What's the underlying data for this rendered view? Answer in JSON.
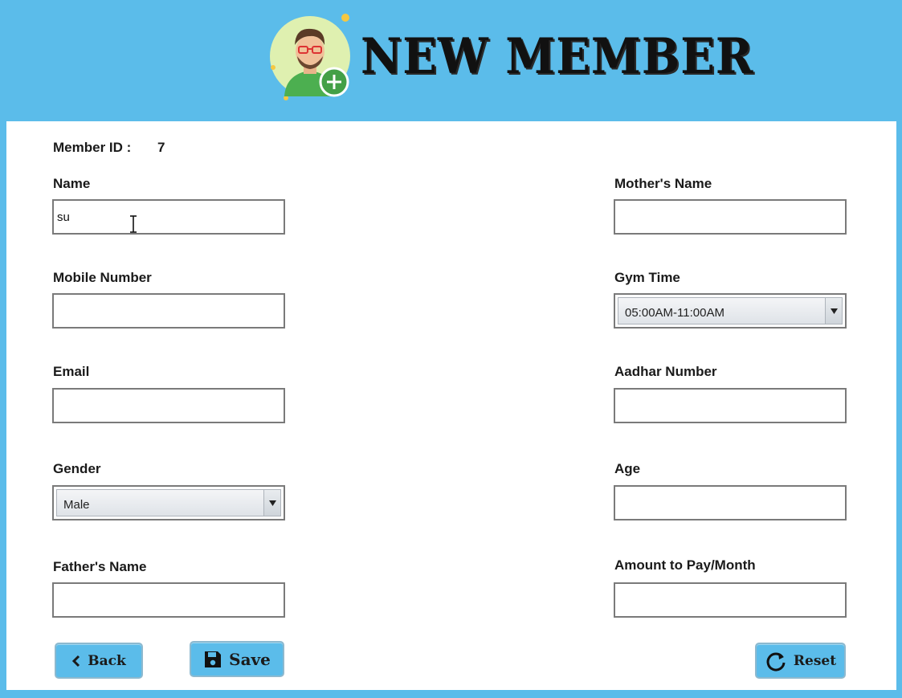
{
  "header": {
    "title": "NEW MEMBER"
  },
  "member_id": {
    "label": "Member ID :",
    "value": "7"
  },
  "form": {
    "name": {
      "label": "Name",
      "value": "su"
    },
    "mobile": {
      "label": "Mobile Number",
      "value": ""
    },
    "email": {
      "label": "Email",
      "value": ""
    },
    "gender": {
      "label": "Gender",
      "selected": "Male"
    },
    "father": {
      "label": "Father's Name",
      "value": ""
    },
    "mother": {
      "label": "Mother's Name",
      "value": ""
    },
    "gym_time": {
      "label": "Gym Time",
      "selected": "05:00AM-11:00AM"
    },
    "aadhar": {
      "label": "Aadhar Number",
      "value": ""
    },
    "age": {
      "label": "Age",
      "value": ""
    },
    "amount": {
      "label": "Amount to Pay/Month",
      "value": ""
    }
  },
  "buttons": {
    "back": "Back",
    "save": "Save",
    "reset": "Reset"
  },
  "colors": {
    "header_bg": "#5bbcea",
    "button_bg": "#5bbcea",
    "panel_bg": "#ffffff"
  },
  "icons": {
    "avatar": "user-add-avatar",
    "back": "chevron-left-icon",
    "save": "floppy-disk-icon",
    "reset": "refresh-icon",
    "dropdown": "triangle-down-icon"
  }
}
